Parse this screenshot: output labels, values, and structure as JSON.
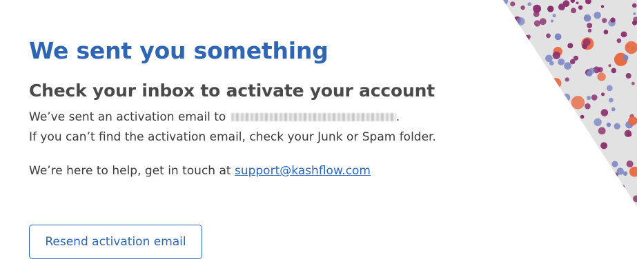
{
  "main": {
    "title": "We sent you something",
    "subtitle": "Check your inbox to activate your account",
    "sent_prefix": "We’ve sent an activation email to",
    "sent_suffix": ".",
    "junk_hint": "If you can’t find the activation email, check your Junk or Spam folder.",
    "help_prefix": "We’re here to help, get in touch at ",
    "support_email": "support@kashflow.com",
    "resend_button": "Resend activation email"
  },
  "colors": {
    "accent": "#2e66b3",
    "decor_gray": "#e2e2e2",
    "dot_purple": "#8a2f6e",
    "dot_blue": "#7a84c4",
    "dot_orange": "#e8673f"
  }
}
